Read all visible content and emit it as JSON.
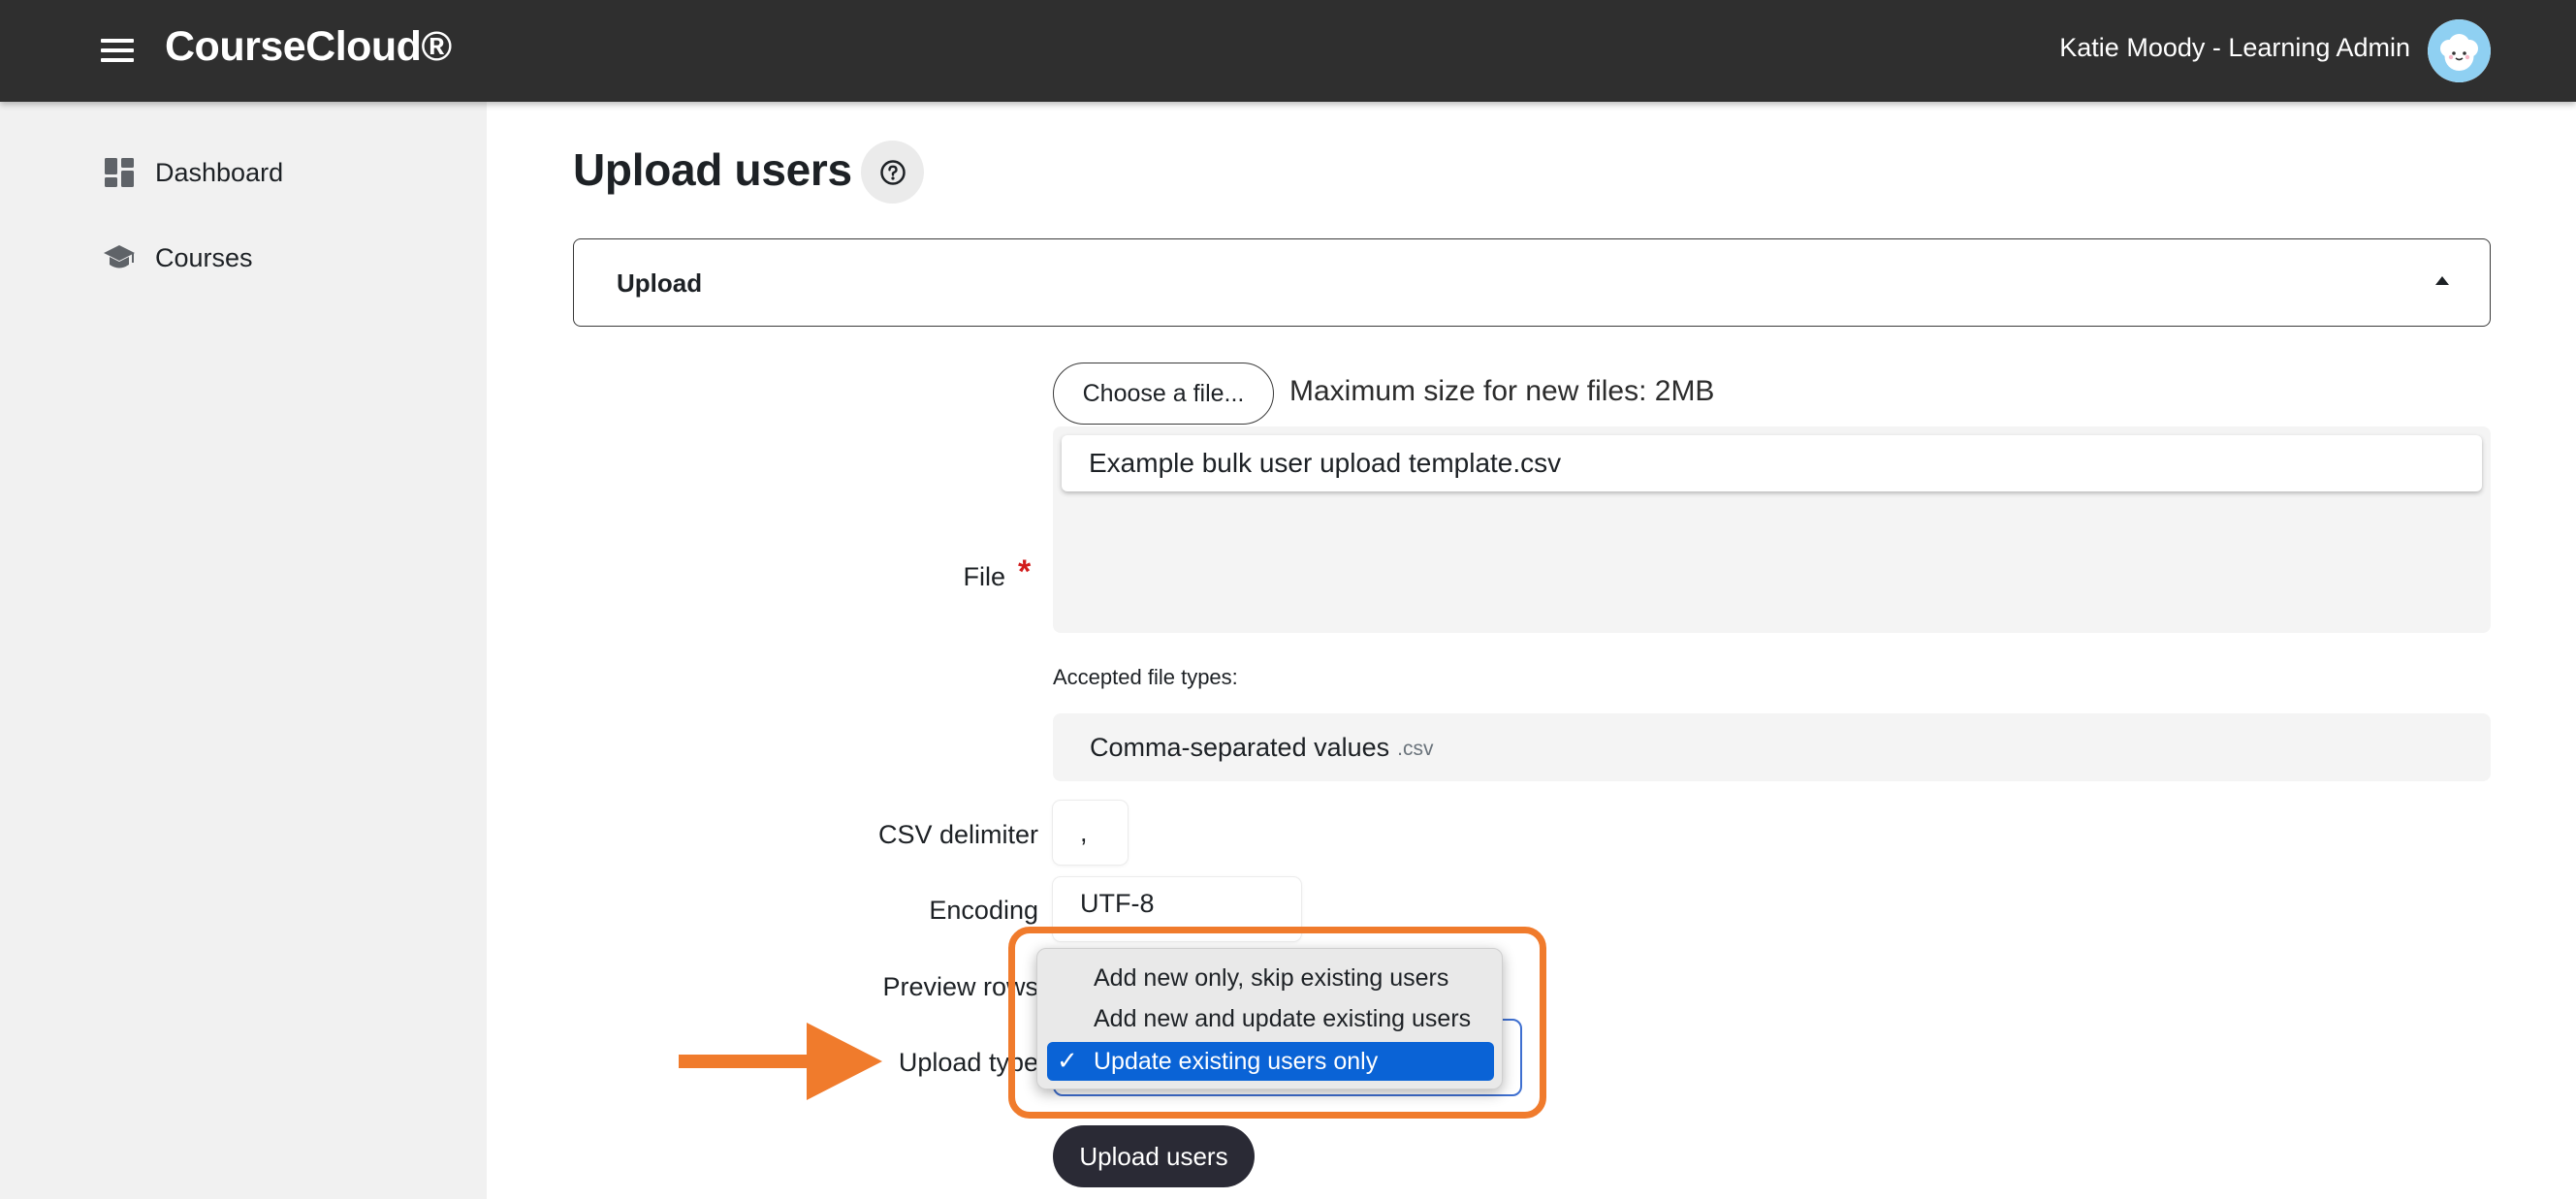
{
  "header": {
    "brand": "CourseCloud®",
    "user_name": "Katie Moody - Learning Admin"
  },
  "sidebar": {
    "items": [
      {
        "label": "Dashboard",
        "icon": "dashboard-icon"
      },
      {
        "label": "Courses",
        "icon": "graduation-cap-icon"
      }
    ]
  },
  "page": {
    "title": "Upload users"
  },
  "section": {
    "title": "Upload"
  },
  "form": {
    "file": {
      "label": "File",
      "required_mark": "*",
      "choose_button": "Choose a file...",
      "max_size_text": "Maximum size for new files: 2MB",
      "selected_file": "Example bulk user upload template.csv",
      "accepted_label": "Accepted file types:",
      "accepted_type_name": "Comma-separated values",
      "accepted_type_ext": ".csv"
    },
    "csv_delimiter": {
      "label": "CSV delimiter",
      "value": ","
    },
    "encoding": {
      "label": "Encoding",
      "value": "UTF-8"
    },
    "preview_rows": {
      "label": "Preview rows"
    },
    "upload_type": {
      "label": "Upload type",
      "options": [
        "Add new only, skip existing users",
        "Add new and update existing users",
        "Update existing users only"
      ],
      "selected": "Update existing users only",
      "check_mark": "✓"
    },
    "submit_label": "Upload users"
  },
  "colors": {
    "topbar": "#2f2f2f",
    "sidebar": "#f1f1f1",
    "highlight": "#f07b2c",
    "selected_option": "#0a63d6",
    "primary_button": "#2a2a35"
  }
}
